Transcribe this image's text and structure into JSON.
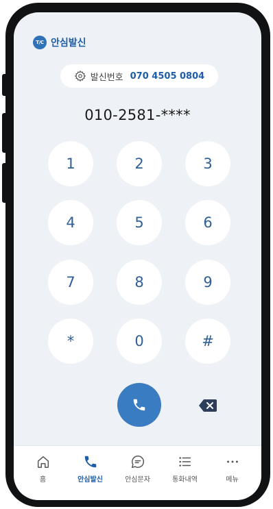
{
  "brand": {
    "logo_text": "T/C",
    "name": "안심발신"
  },
  "caller_id": {
    "label": "발신번호",
    "number": "070 4505 0804"
  },
  "dial_display": "010-2581-****",
  "keypad": [
    "1",
    "2",
    "3",
    "4",
    "5",
    "6",
    "7",
    "8",
    "9",
    "*",
    "0",
    "#"
  ],
  "nav": [
    {
      "label": "홈",
      "icon": "home-icon",
      "active": false
    },
    {
      "label": "안심발신",
      "icon": "phone-icon",
      "active": true
    },
    {
      "label": "안심문자",
      "icon": "chat-icon",
      "active": false
    },
    {
      "label": "통화내역",
      "icon": "list-icon",
      "active": false
    },
    {
      "label": "메뉴",
      "icon": "more-icon",
      "active": false
    }
  ],
  "colors": {
    "accent": "#1f5da8",
    "call_button": "#3a7cc2",
    "background": "#eef1f5",
    "frame": "#111214"
  }
}
